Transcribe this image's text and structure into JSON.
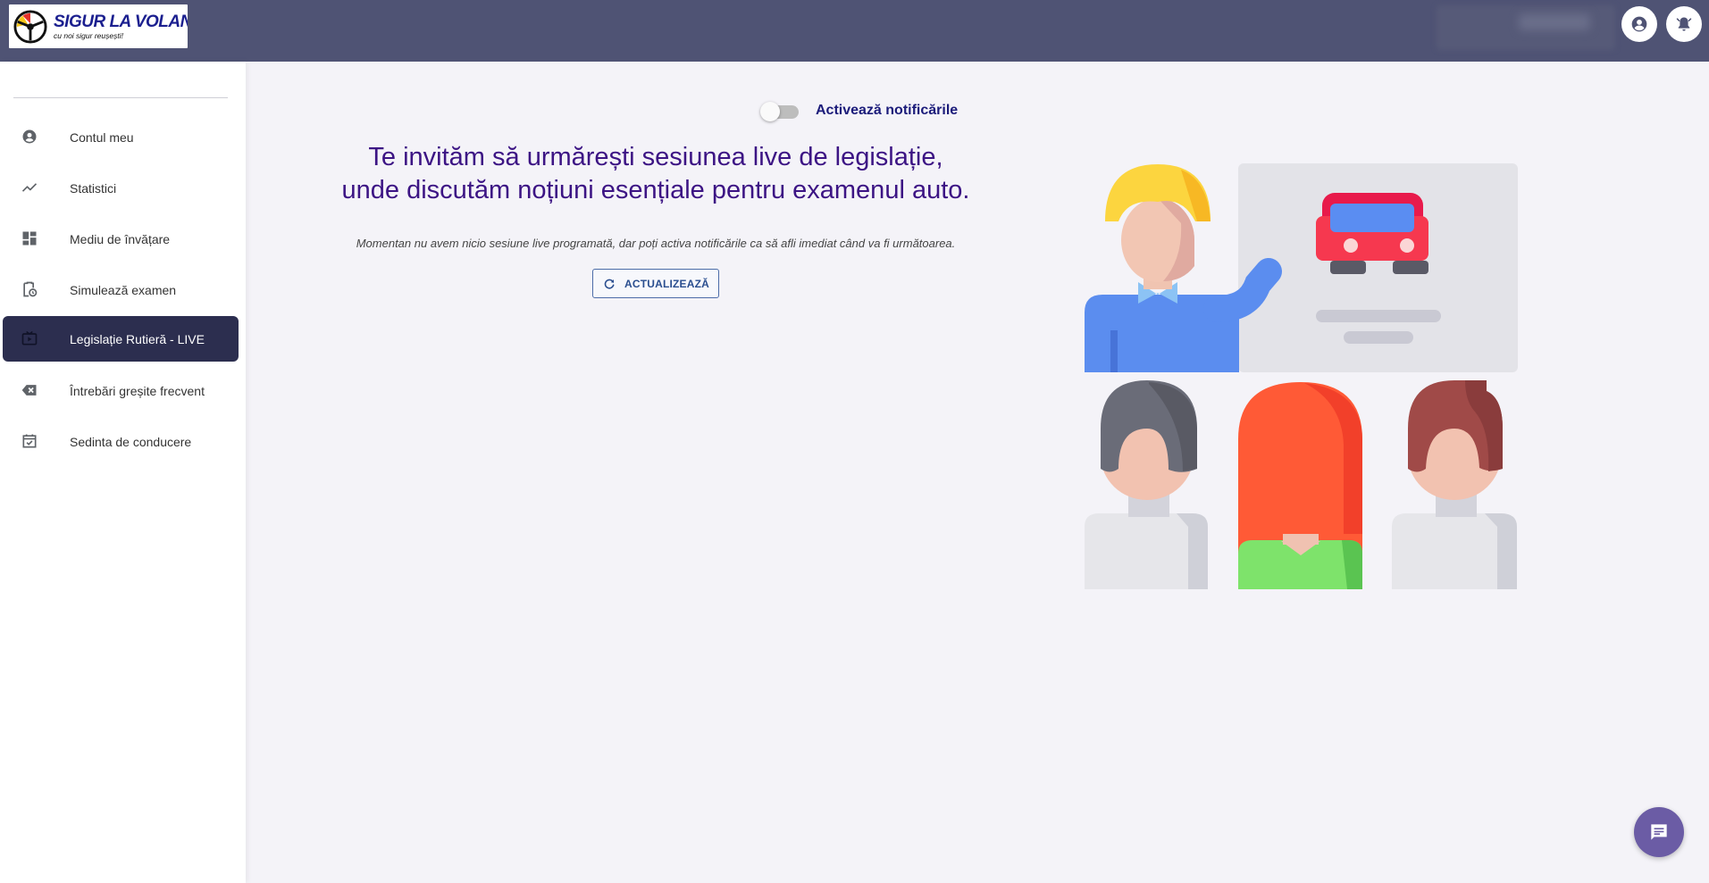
{
  "header": {
    "logo_title": "SIGUR LA VOLAN",
    "logo_subtitle": "cu noi sigur reușești!",
    "account_icon": "account-circle-icon",
    "notifications_icon": "bell-icon"
  },
  "sidebar": {
    "items": [
      {
        "label": "Contul meu",
        "icon": "account-circle-icon"
      },
      {
        "label": "Statistici",
        "icon": "trending-up-icon"
      },
      {
        "label": "Mediu de învățare",
        "icon": "dashboard-icon"
      },
      {
        "label": "Simulează examen",
        "icon": "clipboard-clock-icon"
      },
      {
        "label": "Legislație Rutieră - LIVE",
        "icon": "live-tv-icon",
        "active": true
      },
      {
        "label": "Întrebări greșite frecvent",
        "icon": "backspace-icon"
      },
      {
        "label": "Sedinta de conducere",
        "icon": "calendar-check-icon"
      }
    ]
  },
  "main": {
    "toggle_label": "Activează notificările",
    "toggle_on": false,
    "headline_line1": "Te invităm să urmărești sesiunea live de legislație,",
    "headline_line2": "unde discutăm noțiuni esențiale pentru examenul auto.",
    "info_text": "Momentan nu avem nicio sesiune live programată, dar poți activa notificările ca să afli imediat când va fi următoarea.",
    "refresh_label": "ACTUALIZEAZĂ",
    "illustration": "classroom-illustration"
  },
  "chat": {
    "icon": "chat-icon"
  },
  "colors": {
    "header_bg": "#4f5374",
    "active_nav_bg": "#2c2e4f",
    "headline": "#3c1484",
    "chat_fab": "#6b5ca5"
  }
}
